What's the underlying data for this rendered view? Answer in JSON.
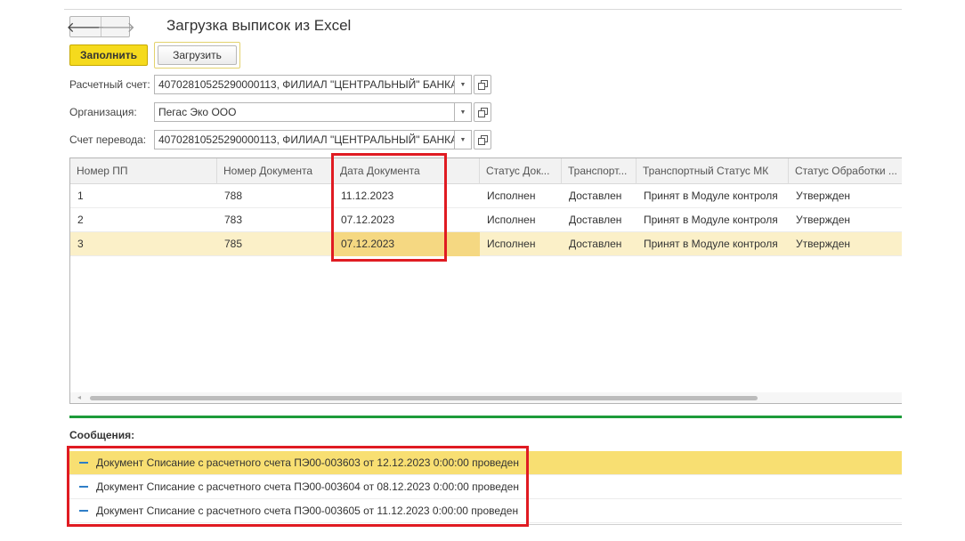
{
  "window": {
    "title": "Загрузка выписок из Excel"
  },
  "nav": {
    "back": "🡐",
    "forward": "🡒"
  },
  "toolbar": {
    "fill_label": "Заполнить",
    "load_label": "Загрузить"
  },
  "form": {
    "account_label": "Расчетный счет:",
    "account_value": "40702810525290000113, ФИЛИАЛ \"ЦЕНТРАЛЬНЫЙ\" БАНКА",
    "org_label": "Организация:",
    "org_value": "Пегас Эко ООО",
    "transfer_label": "Счет перевода:",
    "transfer_value": "40702810525290000113, ФИЛИАЛ \"ЦЕНТРАЛЬНЫЙ\" БАНКА",
    "dropdown_glyph": "▼",
    "open_glyph": "⧉"
  },
  "table": {
    "columns": [
      "Номер ПП",
      "Номер Документа",
      "Дата Документа",
      "Статус Док...",
      "Транспорт...",
      "Транспортный Статус МК",
      "Статус Обработки ..."
    ],
    "rows": [
      [
        "1",
        "788",
        "11.12.2023",
        "Исполнен",
        "Доставлен",
        "Принят в Модуле контроля",
        "Утвержден"
      ],
      [
        "2",
        "783",
        "07.12.2023",
        "Исполнен",
        "Доставлен",
        "Принят в Модуле контроля",
        "Утвержден"
      ],
      [
        "3",
        "785",
        "07.12.2023",
        "Исполнен",
        "Доставлен",
        "Принят в Модуле контроля",
        "Утвержден"
      ]
    ],
    "selected_row": 3
  },
  "messages": {
    "title": "Сообщения:",
    "items": [
      "Документ Списание с расчетного счета ПЭ00-003603 от 12.12.2023 0:00:00 проведен",
      "Документ Списание с расчетного счета ПЭ00-003604 от 08.12.2023 0:00:00 проведен",
      "Документ Списание с расчетного счета ПЭ00-003605 от 11.12.2023 0:00:00 проведен"
    ]
  },
  "colors": {
    "accent_button": "#f5da1d",
    "highlight_box": "#e01b22",
    "separator": "#1c9b3a",
    "selected_row": "#fbf0c8"
  }
}
